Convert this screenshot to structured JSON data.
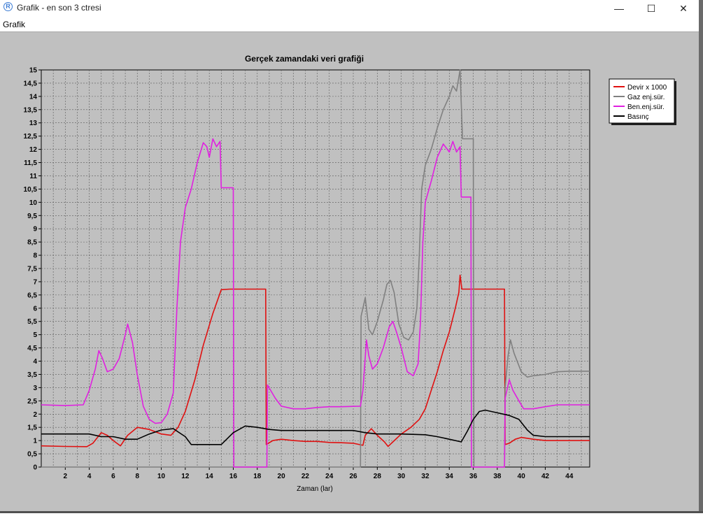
{
  "window": {
    "title": "Grafik - en son 3 ctresi",
    "minimize": "—",
    "maximize": "☐",
    "close": "✕"
  },
  "menu": {
    "items": [
      "Grafik"
    ]
  },
  "chart_data": {
    "type": "line",
    "title": "Gerçek zamandaki veri grafiği",
    "xlabel": "Zaman (lar)",
    "ylabel": "",
    "xlim": [
      0,
      45.7
    ],
    "ylim": [
      0,
      15
    ],
    "xticks": [
      2,
      4,
      6,
      8,
      10,
      12,
      14,
      16,
      18,
      20,
      22,
      24,
      26,
      28,
      30,
      32,
      34,
      36,
      38,
      40,
      42,
      44
    ],
    "yticks": [
      0,
      0.5,
      1,
      1.5,
      2,
      2.5,
      3,
      3.5,
      4,
      4.5,
      5,
      5.5,
      6,
      6.5,
      7,
      7.5,
      8,
      8.5,
      9,
      9.5,
      10,
      10.5,
      11,
      11.5,
      12,
      12.5,
      13,
      13.5,
      14,
      14.5,
      15
    ],
    "ytick_labels": [
      "0",
      "0,5",
      "1",
      "1,5",
      "2",
      "2,5",
      "3",
      "3,5",
      "4",
      "4,5",
      "5",
      "5,5",
      "6",
      "6,5",
      "7",
      "7,5",
      "8",
      "8,5",
      "9",
      "9,5",
      "10",
      "10,5",
      "11",
      "11,5",
      "12",
      "12,5",
      "13",
      "13,5",
      "14",
      "14,5",
      "15"
    ],
    "grid": true,
    "legend_position": "top-right outside",
    "series": [
      {
        "name": "Devir x 1000",
        "color": "#e01010",
        "points": [
          [
            0,
            0.8
          ],
          [
            2,
            0.78
          ],
          [
            3.8,
            0.77
          ],
          [
            4.3,
            0.9
          ],
          [
            5,
            1.3
          ],
          [
            5.5,
            1.2
          ],
          [
            6,
            1.0
          ],
          [
            6.6,
            0.8
          ],
          [
            7.2,
            1.2
          ],
          [
            8,
            1.5
          ],
          [
            9,
            1.42
          ],
          [
            10,
            1.25
          ],
          [
            10.8,
            1.2
          ],
          [
            11.4,
            1.5
          ],
          [
            12,
            2.1
          ],
          [
            12.8,
            3.3
          ],
          [
            13.5,
            4.6
          ],
          [
            14.3,
            5.8
          ],
          [
            15,
            6.7
          ],
          [
            15.7,
            6.72
          ],
          [
            16,
            6.72
          ],
          [
            17,
            6.72
          ],
          [
            18.7,
            6.72
          ],
          [
            18.75,
            0.85
          ],
          [
            19.3,
            1.0
          ],
          [
            20,
            1.05
          ],
          [
            21,
            1.0
          ],
          [
            22,
            0.97
          ],
          [
            23,
            0.97
          ],
          [
            24,
            0.93
          ],
          [
            25,
            0.92
          ],
          [
            26,
            0.9
          ],
          [
            26.8,
            0.82
          ],
          [
            27,
            1.2
          ],
          [
            27.5,
            1.45
          ],
          [
            28,
            1.2
          ],
          [
            28.6,
            0.95
          ],
          [
            28.9,
            0.78
          ],
          [
            29.3,
            0.95
          ],
          [
            30,
            1.25
          ],
          [
            30.8,
            1.5
          ],
          [
            31.5,
            1.8
          ],
          [
            32,
            2.2
          ],
          [
            32.5,
            2.9
          ],
          [
            33,
            3.6
          ],
          [
            33.5,
            4.4
          ],
          [
            34,
            5.1
          ],
          [
            34.5,
            6.0
          ],
          [
            34.8,
            6.6
          ],
          [
            34.9,
            7.25
          ],
          [
            35.05,
            6.72
          ],
          [
            36,
            6.72
          ],
          [
            37,
            6.72
          ],
          [
            38.6,
            6.72
          ],
          [
            38.65,
            0.85
          ],
          [
            39,
            0.9
          ],
          [
            39.5,
            1.05
          ],
          [
            40,
            1.12
          ],
          [
            41,
            1.05
          ],
          [
            42,
            1.0
          ],
          [
            44,
            1.0
          ],
          [
            45.7,
            1.0
          ]
        ]
      },
      {
        "name": "Gaz enj.sür.",
        "color": "#808080",
        "points": [
          [
            0,
            0
          ],
          [
            26.6,
            0
          ],
          [
            26.65,
            5.7
          ],
          [
            27,
            6.4
          ],
          [
            27.3,
            5.2
          ],
          [
            27.6,
            5.0
          ],
          [
            28,
            5.5
          ],
          [
            28.5,
            6.3
          ],
          [
            28.8,
            6.9
          ],
          [
            29.1,
            7.05
          ],
          [
            29.4,
            6.6
          ],
          [
            29.8,
            5.4
          ],
          [
            30.2,
            4.9
          ],
          [
            30.6,
            4.8
          ],
          [
            31,
            5.1
          ],
          [
            31.3,
            6.0
          ],
          [
            31.5,
            8.0
          ],
          [
            31.7,
            10.5
          ],
          [
            32,
            11.4
          ],
          [
            32.5,
            12.0
          ],
          [
            33,
            12.8
          ],
          [
            33.5,
            13.5
          ],
          [
            34,
            14.0
          ],
          [
            34.3,
            14.4
          ],
          [
            34.6,
            14.2
          ],
          [
            34.9,
            15.0
          ],
          [
            35.1,
            12.4
          ],
          [
            36,
            12.4
          ],
          [
            36.05,
            0
          ],
          [
            38.6,
            0
          ],
          [
            38.65,
            3.0
          ],
          [
            38.9,
            4.2
          ],
          [
            39.1,
            4.8
          ],
          [
            39.4,
            4.3
          ],
          [
            40,
            3.6
          ],
          [
            40.5,
            3.4
          ],
          [
            41,
            3.45
          ],
          [
            42,
            3.5
          ],
          [
            43,
            3.6
          ],
          [
            44,
            3.62
          ],
          [
            45.7,
            3.62
          ]
        ]
      },
      {
        "name": "Ben.enj.sür.",
        "color": "#e020e0",
        "points": [
          [
            0,
            2.35
          ],
          [
            2,
            2.32
          ],
          [
            3.5,
            2.35
          ],
          [
            4,
            2.9
          ],
          [
            4.5,
            3.7
          ],
          [
            4.8,
            4.4
          ],
          [
            5.1,
            4.1
          ],
          [
            5.5,
            3.6
          ],
          [
            6,
            3.7
          ],
          [
            6.5,
            4.1
          ],
          [
            7,
            5.0
          ],
          [
            7.2,
            5.4
          ],
          [
            7.6,
            4.7
          ],
          [
            8,
            3.5
          ],
          [
            8.5,
            2.3
          ],
          [
            9,
            1.8
          ],
          [
            9.5,
            1.65
          ],
          [
            10,
            1.68
          ],
          [
            10.5,
            2.0
          ],
          [
            11,
            2.8
          ],
          [
            11.3,
            6.0
          ],
          [
            11.6,
            8.5
          ],
          [
            12,
            9.8
          ],
          [
            12.5,
            10.5
          ],
          [
            13,
            11.5
          ],
          [
            13.5,
            12.25
          ],
          [
            13.8,
            12.1
          ],
          [
            14,
            11.7
          ],
          [
            14.3,
            12.4
          ],
          [
            14.6,
            12.1
          ],
          [
            14.9,
            12.3
          ],
          [
            15,
            10.55
          ],
          [
            16,
            10.55
          ],
          [
            16.05,
            0
          ],
          [
            18.8,
            0
          ],
          [
            18.85,
            3.1
          ],
          [
            19.5,
            2.6
          ],
          [
            20,
            2.3
          ],
          [
            21,
            2.2
          ],
          [
            22,
            2.2
          ],
          [
            23,
            2.25
          ],
          [
            24,
            2.28
          ],
          [
            25,
            2.28
          ],
          [
            26.6,
            2.3
          ],
          [
            26.8,
            2.9
          ],
          [
            27.1,
            4.8
          ],
          [
            27.3,
            4.2
          ],
          [
            27.6,
            3.7
          ],
          [
            28,
            3.9
          ],
          [
            28.5,
            4.5
          ],
          [
            29,
            5.3
          ],
          [
            29.3,
            5.5
          ],
          [
            29.6,
            5.1
          ],
          [
            30,
            4.5
          ],
          [
            30.5,
            3.6
          ],
          [
            31,
            3.45
          ],
          [
            31.4,
            3.9
          ],
          [
            31.6,
            5.5
          ],
          [
            31.8,
            8.5
          ],
          [
            32,
            10.0
          ],
          [
            32.5,
            10.8
          ],
          [
            33,
            11.7
          ],
          [
            33.5,
            12.2
          ],
          [
            34,
            11.9
          ],
          [
            34.3,
            12.3
          ],
          [
            34.6,
            11.9
          ],
          [
            34.9,
            12.1
          ],
          [
            35,
            10.2
          ],
          [
            35.8,
            10.2
          ],
          [
            35.85,
            0
          ],
          [
            38.6,
            0
          ],
          [
            38.65,
            2.6
          ],
          [
            39,
            3.3
          ],
          [
            39.3,
            2.9
          ],
          [
            39.8,
            2.5
          ],
          [
            40.2,
            2.2
          ],
          [
            41,
            2.2
          ],
          [
            42,
            2.28
          ],
          [
            43,
            2.35
          ],
          [
            44,
            2.35
          ],
          [
            45.7,
            2.35
          ]
        ]
      },
      {
        "name": "Basınç",
        "color": "#000000",
        "points": [
          [
            0,
            1.25
          ],
          [
            4,
            1.25
          ],
          [
            5,
            1.15
          ],
          [
            6,
            1.15
          ],
          [
            7,
            1.05
          ],
          [
            8,
            1.05
          ],
          [
            9,
            1.25
          ],
          [
            10,
            1.4
          ],
          [
            11,
            1.45
          ],
          [
            12,
            1.15
          ],
          [
            12.5,
            0.85
          ],
          [
            15,
            0.85
          ],
          [
            16,
            1.3
          ],
          [
            17,
            1.55
          ],
          [
            18,
            1.5
          ],
          [
            19,
            1.42
          ],
          [
            20,
            1.38
          ],
          [
            21,
            1.38
          ],
          [
            22,
            1.38
          ],
          [
            24,
            1.38
          ],
          [
            26,
            1.38
          ],
          [
            27,
            1.3
          ],
          [
            28,
            1.25
          ],
          [
            30,
            1.25
          ],
          [
            32,
            1.22
          ],
          [
            33,
            1.15
          ],
          [
            34,
            1.05
          ],
          [
            35,
            0.95
          ],
          [
            35.5,
            1.35
          ],
          [
            36,
            1.8
          ],
          [
            36.5,
            2.1
          ],
          [
            37,
            2.15
          ],
          [
            38,
            2.05
          ],
          [
            38.5,
            2.0
          ],
          [
            39,
            1.95
          ],
          [
            39.8,
            1.8
          ],
          [
            40.5,
            1.4
          ],
          [
            41,
            1.2
          ],
          [
            42,
            1.15
          ],
          [
            45.7,
            1.15
          ]
        ]
      }
    ]
  }
}
